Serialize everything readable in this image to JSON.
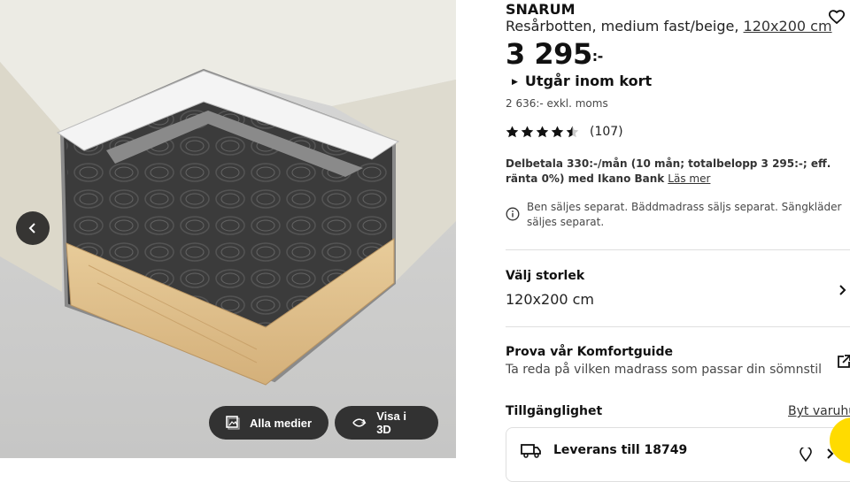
{
  "media": {
    "prev_label": "Föregående bild",
    "all_media_label": "Alla medier",
    "view_3d_label": "Visa i 3D"
  },
  "product": {
    "name": "SNARUM",
    "description": "Resårbotten, medium fast/beige,",
    "size": "120x200 cm",
    "price_main": "3 295",
    "price_suffix": ":-",
    "stock_status": "Utgår inom kort",
    "price_ex_vat": "2 636:- exkl. moms",
    "rating": 4.5,
    "rating_count": "(107)",
    "financing": "Delbetala 330:-/mån (10 mån; totalbelopp 3 295:-; eff. ränta 0%) med Ikano Bank",
    "financing_link": "Läs mer",
    "notice": "Ben säljes separat. Bäddmadrass säljs separat. Sängkläder säljes separat."
  },
  "size_select": {
    "label": "Välj storlek",
    "value": "120x200 cm"
  },
  "comfort_guide": {
    "title": "Prova vår Komfortguide",
    "subtitle": "Ta reda på vilken madrass som passar din sömnstil"
  },
  "availability": {
    "title": "Tillgänglighet",
    "change_store": "Byt varuhus",
    "delivery": "Leverans till 18749"
  },
  "colors": {
    "dark_overlay": "#111111",
    "chat_yellow": "#ffdb00",
    "divider": "#dfdfdf"
  }
}
